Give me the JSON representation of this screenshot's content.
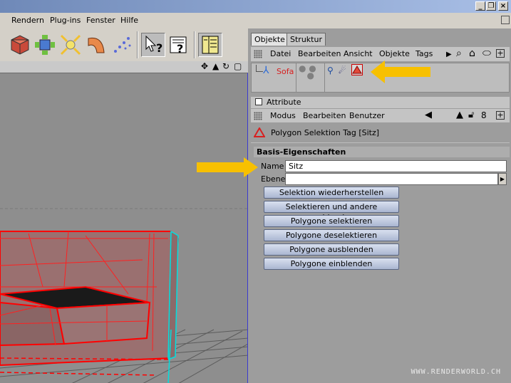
{
  "menubar": {
    "items": [
      "Rendern",
      "Plug-ins",
      "Fenster",
      "Hilfe"
    ]
  },
  "window_controls": [
    "_",
    "❐",
    "×"
  ],
  "tabs": [
    "Objekte",
    "Struktur"
  ],
  "object_manager": {
    "menu": [
      "Datei",
      "Bearbeiten",
      "Ansicht",
      "Objekte",
      "Tags"
    ],
    "object_name": "Sofa"
  },
  "attribute_manager": {
    "title": "Attribute",
    "menu": [
      "Modus",
      "Bearbeiten",
      "Benutzer"
    ],
    "tag_title": "Polygon Selektion Tag [Sitz]",
    "group": "Basis-Eigenschaften",
    "name_label": "Name",
    "name_value": "Sitz",
    "layer_label": "Ebene",
    "layer_value": "",
    "buttons": [
      "Selektion wiederherstellen",
      "Selektieren und andere ausblenden",
      "Polygone selektieren",
      "Polygone deselektieren",
      "Polygone ausblenden",
      "Polygone einblenden"
    ]
  },
  "watermark": "WWW.RENDERWORLD.CH",
  "colors": {
    "accent_arrow": "#f7c000",
    "selection_red": "#ff0000",
    "button_blue": "#aab6d1"
  }
}
